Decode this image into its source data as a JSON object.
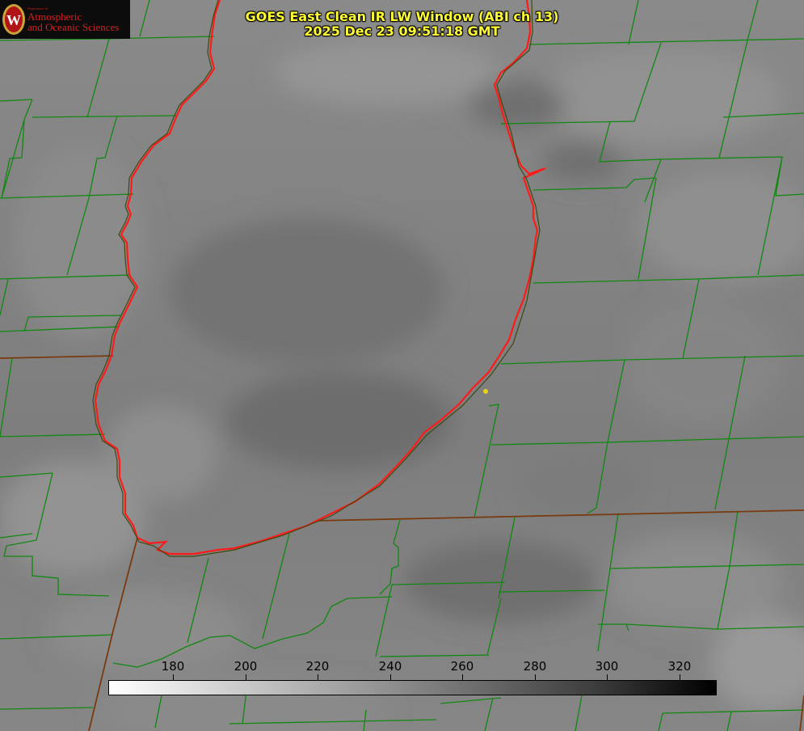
{
  "title": {
    "line1": "GOES East Clean IR LW Window (ABI ch 13)",
    "line2": "2025 Dec 23 09:51:18 GMT"
  },
  "logo": {
    "department": "Department of",
    "line1": "Atmospheric",
    "line2": "and Oceanic Sciences",
    "seal_letter": "W"
  },
  "colorbar": {
    "ticks": [
      "180",
      "200",
      "220",
      "240",
      "260",
      "280",
      "300",
      "320"
    ]
  },
  "colors": {
    "lake_outline": "#ff1a1a",
    "county_lines": "#118811",
    "state_lines": "#7a3a10",
    "title_text": "#ffff33",
    "marker": "#e8d21a"
  }
}
